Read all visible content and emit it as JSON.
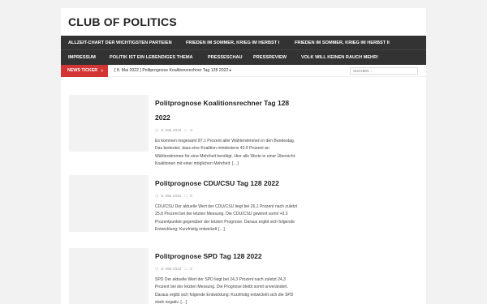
{
  "site": {
    "title": "CLUB OF POLITICS"
  },
  "nav": {
    "row1": [
      "ALLZEIT-CHART DER WICHTIGSTEN PARTEIEN",
      "FRIEDEN IM SOMMER, KRIEG IM HERBST I",
      "FRIEDEN IM SOMMER, KRIEG IM HERBST II"
    ],
    "row2": [
      "IMPRESSUM",
      "POLITIK IST EIN LEBENDIGES THEMA",
      "PRESSESCHAU",
      "PRESSREVIEW",
      "VOLK WILL KEINEN RAUCH MEHR!"
    ]
  },
  "ticker": {
    "label": "NEWS TICKER",
    "chevron": "›",
    "text": "[ 8. Mai 2022 ]  Politprognose Koalitionsrechner Tag 128 2022  ▸",
    "search_placeholder": "SUCHEN ..."
  },
  "articles": [
    {
      "title": "Politprognose Koalitionsrechner Tag 128 2022",
      "date": "8. Mai 2022",
      "comments": "0",
      "excerpt": "Es kommen insgesamt 87.1 Prozent aller Wählerstimmen in den Bundestag. Das bedeutet, dass eine Koalition mindestens 43.6 Prozent an Wählerstimmen für eine Mehrheit benötigt. Hier alle Werte in einer Übersicht: Koalitionen mit einer möglichen Mehrheit:",
      "more": "[…]"
    },
    {
      "title": "Politprognose CDU/CSU Tag 128 2022",
      "date": "8. Mai 2022",
      "comments": "0",
      "excerpt": "CDU/CSU Der aktuelle Wert der CDU/CSU liegt bei 26,1 Prozent nach zuletzt 25,8 Prozent bei der letzten Messung. Die CDU/CSU gewinnt somit +0.3 Prozentpunkte gegenüber der letzten Prognose. Daraus ergibt sich folgende Entwicklung: Kurzfristig entwickelt",
      "more": "[…]"
    },
    {
      "title": "Politprognose SPD Tag 128 2022",
      "date": "8. Mai 2022",
      "comments": "0",
      "excerpt": "SPD Der aktuelle Wert der SPD liegt bei 24,3 Prozent nach zuletzt 24,3 Prozent bei der letzten Messung. Die Prognose bleibt somit unverändert. Daraus ergibt sich folgende Entwicklung: Kurzfristig entwickelt sich die SPD stark negativ.",
      "more": "[…]"
    }
  ],
  "icons": {
    "date": "clock-icon",
    "comments": "comment-icon"
  },
  "colors": {
    "nav_bg": "#333333",
    "ticker_accent": "#d23534"
  }
}
